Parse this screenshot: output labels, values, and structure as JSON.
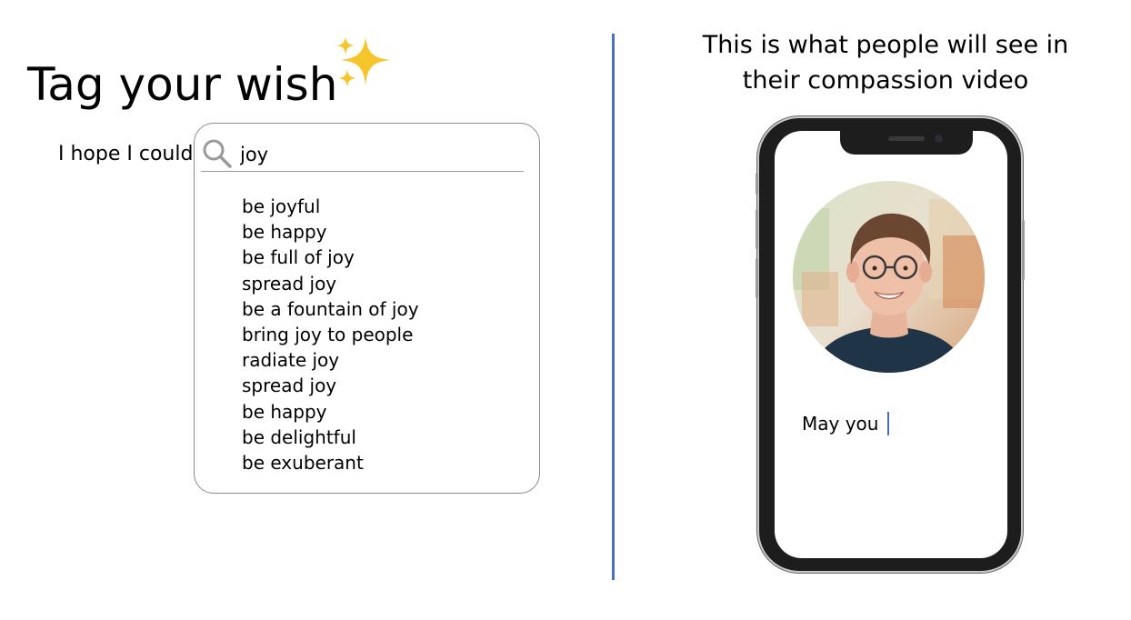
{
  "header": {
    "title": "Tag your wish",
    "title_emoji": "sparkles-icon"
  },
  "wish_form": {
    "prompt_label": "I hope I could",
    "search": {
      "value": "joy",
      "placeholder": ""
    },
    "suggestions": [
      "be joyful",
      "be happy",
      "be full of joy",
      "spread joy",
      "be a fountain of joy",
      "bring joy to people",
      "radiate joy",
      "spread joy",
      "be happy",
      "be delightful",
      "be exuberant"
    ]
  },
  "preview": {
    "heading_line1": "This is what people will see in",
    "heading_line2": "their compassion video",
    "wish_text": "May you"
  },
  "colors": {
    "accent": "#4a6fc0",
    "sparkle": "#f5c52b",
    "border": "#8a8a8a"
  }
}
